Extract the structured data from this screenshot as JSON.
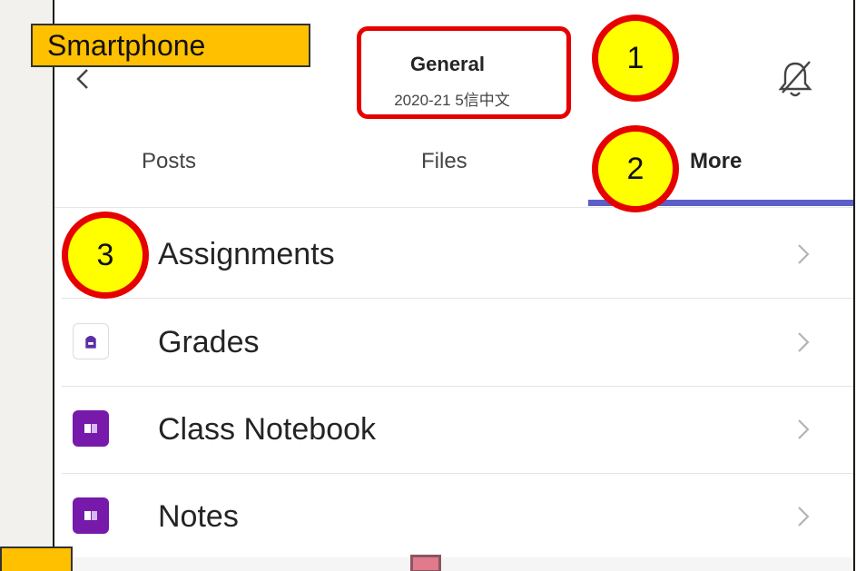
{
  "device_label": "Smartphone",
  "header": {
    "title": "General",
    "subtitle": "2020-21 5信中文",
    "back_icon": "chevron-left-icon",
    "mute_icon": "bell-off-icon"
  },
  "tabs": [
    {
      "label": "Posts",
      "active": false
    },
    {
      "label": "Files",
      "active": false
    },
    {
      "label": "More",
      "active": true
    }
  ],
  "list": [
    {
      "label": "Assignments",
      "icon": "assignments-icon"
    },
    {
      "label": "Grades",
      "icon": "grades-icon"
    },
    {
      "label": "Class Notebook",
      "icon": "onenote-icon"
    },
    {
      "label": "Notes",
      "icon": "onenote-icon"
    }
  ],
  "callouts": [
    "1",
    "2",
    "3"
  ],
  "colors": {
    "accent": "#5b5fc7",
    "onenote": "#7719aa",
    "callout_fill": "#ffff00",
    "callout_border": "#e60000",
    "label_fill": "#ffc000"
  }
}
